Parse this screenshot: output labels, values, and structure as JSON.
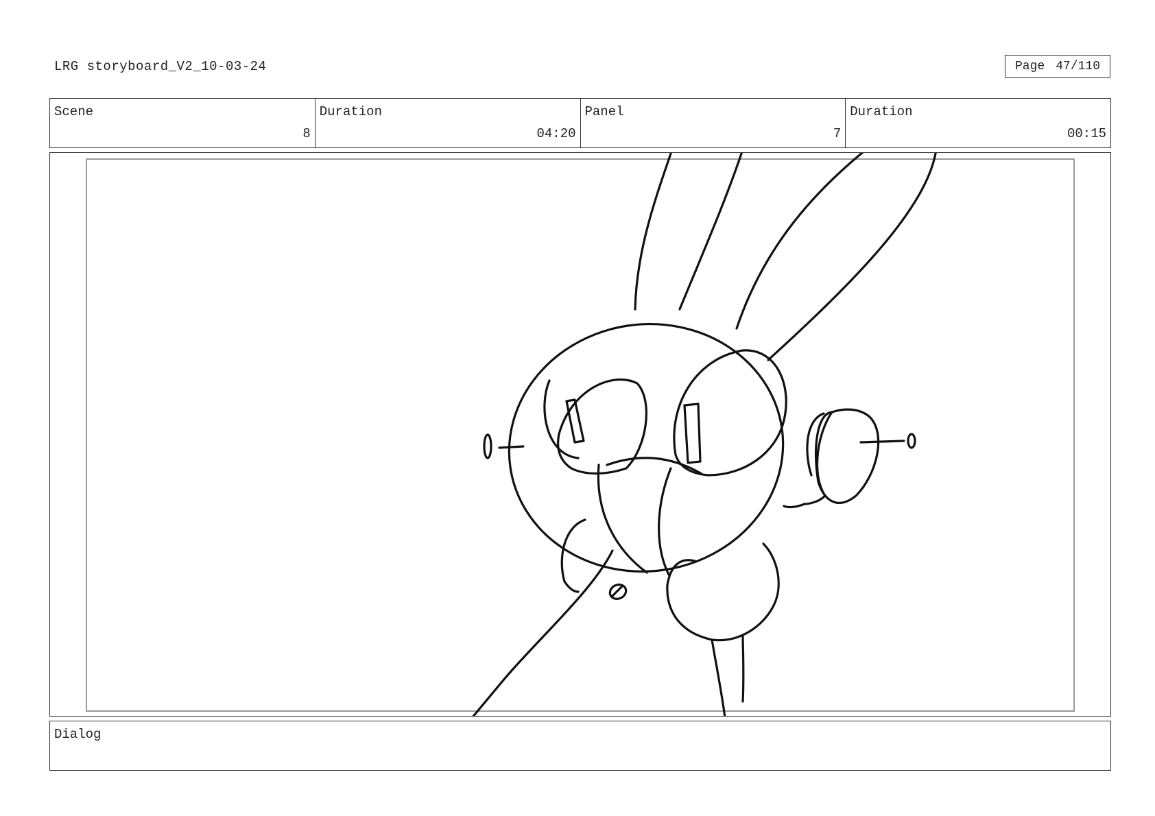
{
  "header": {
    "document_title": "LRG storyboard_V2_10-03-24",
    "page_label": "Page",
    "page_number": "47/110"
  },
  "info": {
    "scene_label": "Scene",
    "scene_value": "8",
    "scene_duration_label": "Duration",
    "scene_duration_value": "04:20",
    "panel_label": "Panel",
    "panel_value": "7",
    "panel_duration_label": "Duration",
    "panel_duration_value": "00:15"
  },
  "panel": {
    "drawing": "rabbit-robot-sketch-icon"
  },
  "dialog": {
    "label": "Dialog",
    "text": ""
  }
}
